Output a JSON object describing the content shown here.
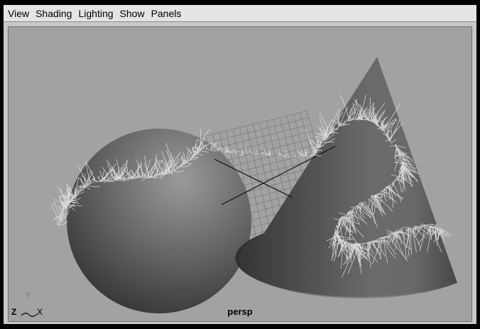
{
  "menubar": {
    "items": [
      "View",
      "Shading",
      "Lighting",
      "Show",
      "Panels"
    ]
  },
  "viewport": {
    "camera_label": "persp",
    "axis_labels": {
      "y": "Y",
      "z": "Z",
      "x": "X"
    }
  },
  "colors": {
    "viewport_bg": "#a2a2a2",
    "menubar_bg": "#e4e4e4",
    "grid_line": "#7d7d7d",
    "fur": "#e8e8e8"
  },
  "scene": {
    "objects": [
      "sphere",
      "cone",
      "grid",
      "fur-strands"
    ]
  }
}
